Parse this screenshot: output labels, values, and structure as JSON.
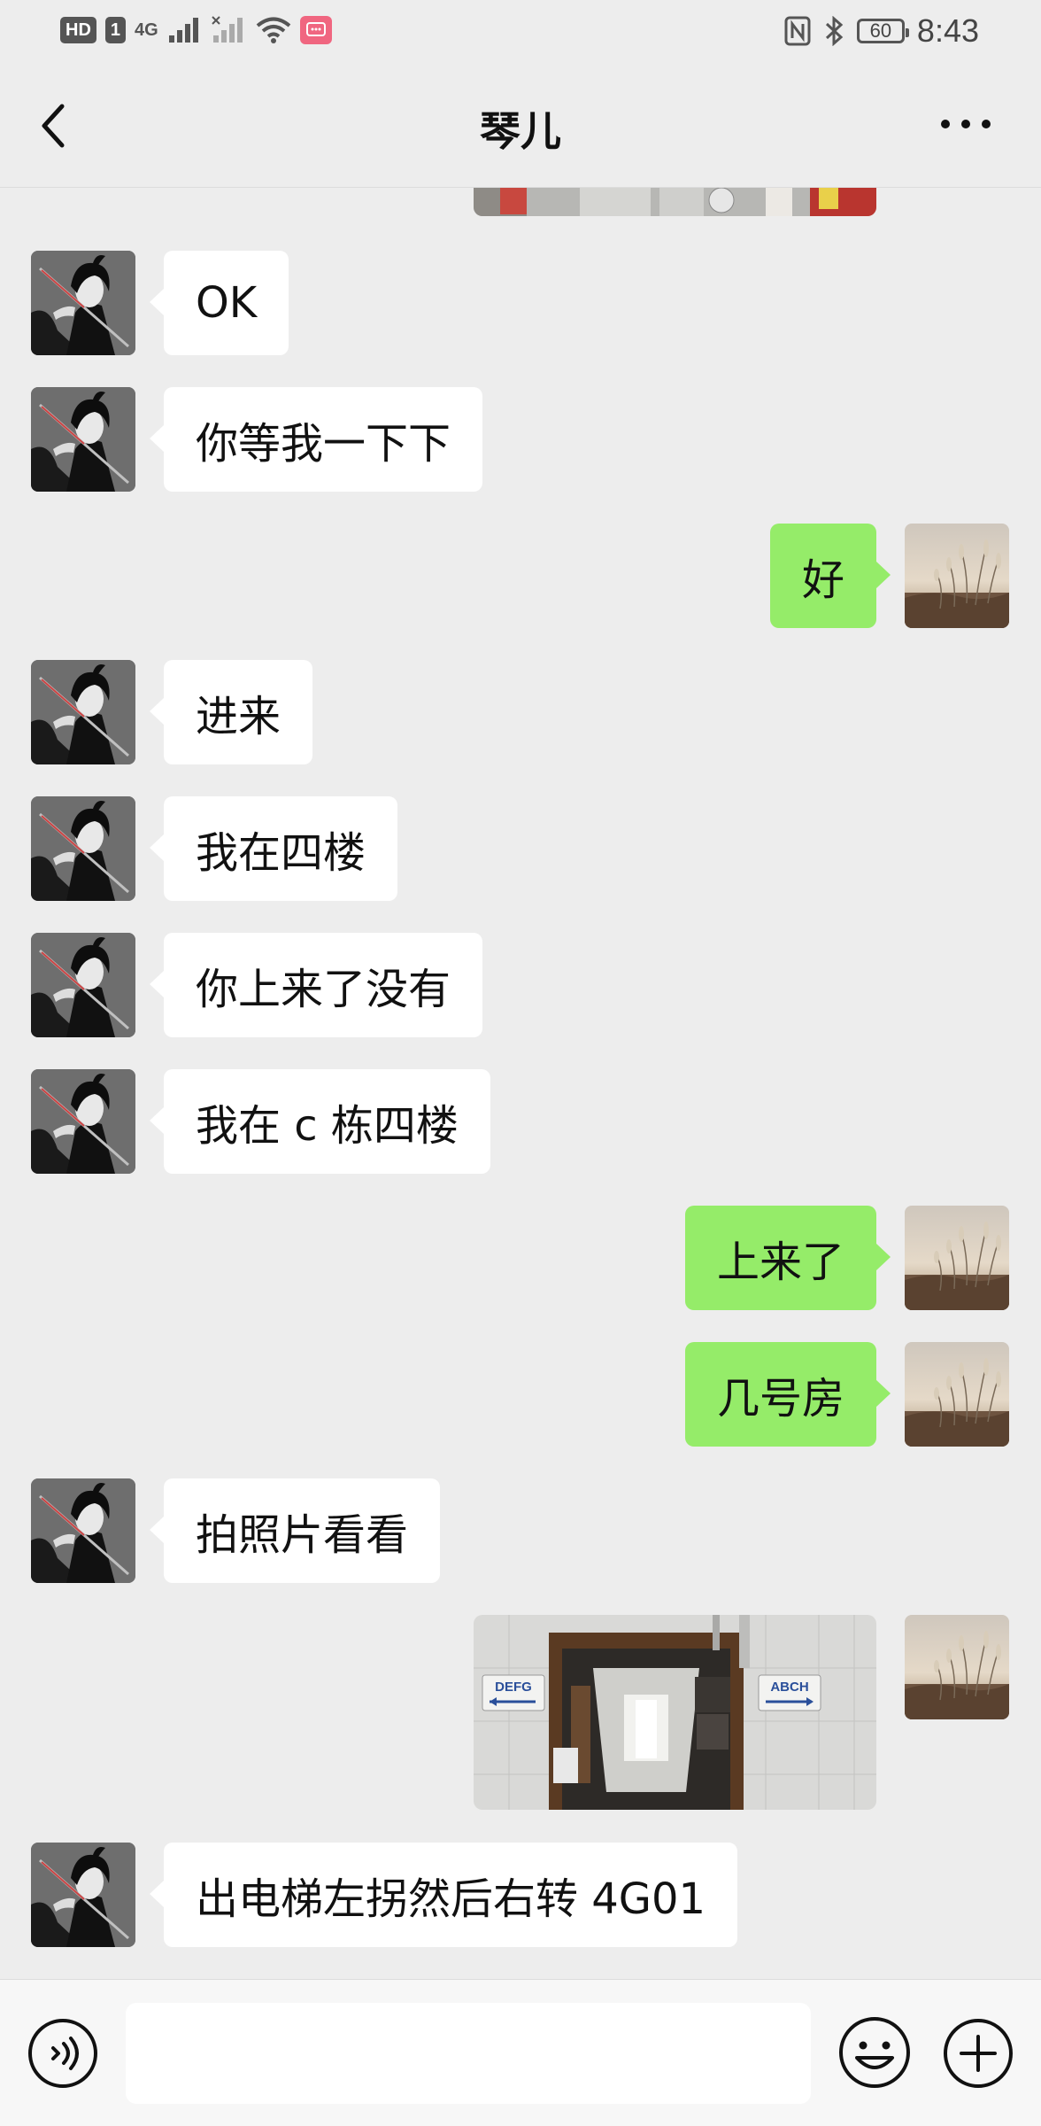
{
  "status_bar": {
    "hd_label": "HD",
    "sim_label": "1",
    "network_label": "4G",
    "battery_level": "60",
    "time": "8:43"
  },
  "header": {
    "title": "琴儿"
  },
  "messages": [
    {
      "from": "them",
      "text": "OK"
    },
    {
      "from": "them",
      "text": "你等我一下下"
    },
    {
      "from": "me",
      "text": "好"
    },
    {
      "from": "them",
      "text": "进来"
    },
    {
      "from": "them",
      "text": "我在四楼"
    },
    {
      "from": "them",
      "text": "你上来了没有"
    },
    {
      "from": "them",
      "text": "我在 c 栋四楼"
    },
    {
      "from": "me",
      "text": "上来了"
    },
    {
      "from": "me",
      "text": "几号房"
    },
    {
      "from": "them",
      "text": "拍照片看看"
    },
    {
      "from": "me",
      "type": "image",
      "sign_left": "DEFG",
      "sign_right": "ABCH"
    },
    {
      "from": "them",
      "text": "出电梯左拐然后右转 4G01"
    }
  ],
  "input_bar": {
    "input_value": "",
    "voice_icon": "voice-icon",
    "emoji_icon": "emoji-icon",
    "plus_icon": "plus-icon"
  },
  "colors": {
    "background": "#ededed",
    "my_bubble": "#95ec69",
    "their_bubble": "#ffffff"
  }
}
